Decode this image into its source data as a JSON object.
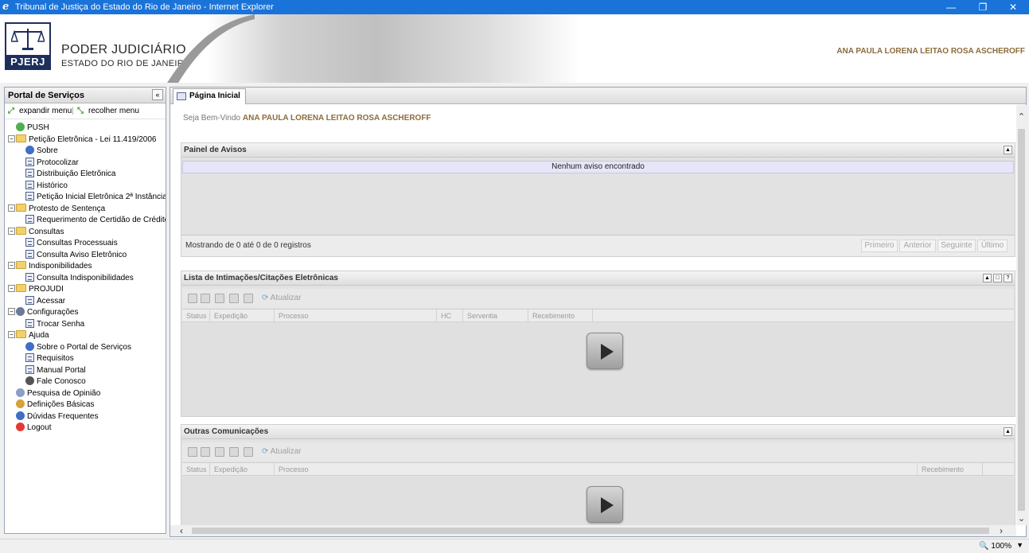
{
  "window": {
    "title": "Tribunal de Justiça do Estado do Rio de Janeiro - Internet Explorer",
    "minimize": "—",
    "restore": "❐",
    "close": "✕"
  },
  "header": {
    "logo_text": "PJERJ",
    "org_line1": "PODER JUDICIÁRIO",
    "org_line2": "ESTADO DO RIO DE JANEIRO",
    "user_name": "ANA PAULA LORENA LEITAO ROSA ASCHEROFF"
  },
  "sidebar": {
    "title": "Portal de Serviços",
    "collapse_glyph": "«",
    "expand_label": "expandir menu",
    "collapse_label": "recolher menu",
    "separator": "|",
    "tree": [
      {
        "label": "PUSH",
        "icon": "green-plus-icon",
        "level": 0,
        "toggle": ""
      },
      {
        "label": "Petição Eletrônica - Lei 11.419/2006",
        "icon": "folder-open-icon",
        "level": 0,
        "toggle": "−"
      },
      {
        "label": "Sobre",
        "icon": "info-icon",
        "level": 1,
        "toggle": ""
      },
      {
        "label": "Protocolizar",
        "icon": "page-icon",
        "level": 1,
        "toggle": ""
      },
      {
        "label": "Distribuição Eletrônica",
        "icon": "page-icon",
        "level": 1,
        "toggle": ""
      },
      {
        "label": "Histórico",
        "icon": "page-icon",
        "level": 1,
        "toggle": ""
      },
      {
        "label": "Petição Inicial Eletrônica 2ª Instância",
        "icon": "page-icon",
        "level": 1,
        "toggle": ""
      },
      {
        "label": "Protesto de Sentença",
        "icon": "folder-open-icon",
        "level": 0,
        "toggle": "−"
      },
      {
        "label": "Requerimento de Certidão de Crédito para",
        "icon": "page-icon",
        "level": 1,
        "toggle": ""
      },
      {
        "label": "Consultas",
        "icon": "folder-open-icon",
        "level": 0,
        "toggle": "−"
      },
      {
        "label": "Consultas Processuais",
        "icon": "page-icon",
        "level": 1,
        "toggle": ""
      },
      {
        "label": "Consulta Aviso Eletrônico",
        "icon": "page-icon",
        "level": 1,
        "toggle": ""
      },
      {
        "label": "Indisponibilidades",
        "icon": "folder-open-icon",
        "level": 0,
        "toggle": "−"
      },
      {
        "label": "Consulta Indisponibilidades",
        "icon": "page-icon",
        "level": 1,
        "toggle": ""
      },
      {
        "label": "PROJUDI",
        "icon": "folder-open-icon",
        "level": 0,
        "toggle": "−"
      },
      {
        "label": "Acessar",
        "icon": "page-icon",
        "level": 1,
        "toggle": ""
      },
      {
        "label": "Configurações",
        "icon": "wrench-icon",
        "level": 0,
        "toggle": "−"
      },
      {
        "label": "Trocar Senha",
        "icon": "page-icon",
        "level": 1,
        "toggle": ""
      },
      {
        "label": "Ajuda",
        "icon": "folder-open-icon",
        "level": 0,
        "toggle": "−"
      },
      {
        "label": "Sobre o Portal de Serviços",
        "icon": "info-icon",
        "level": 1,
        "toggle": ""
      },
      {
        "label": "Requisitos",
        "icon": "page-icon",
        "level": 1,
        "toggle": ""
      },
      {
        "label": "Manual Portal",
        "icon": "page-icon",
        "level": 1,
        "toggle": ""
      },
      {
        "label": "Fale Conosco",
        "icon": "headset-icon",
        "level": 1,
        "toggle": ""
      },
      {
        "label": "Pesquisa de Opinião",
        "icon": "speech-bubble-icon",
        "level": 0,
        "toggle": ""
      },
      {
        "label": "Definições Básicas",
        "icon": "pencil-icon",
        "level": 0,
        "toggle": ""
      },
      {
        "label": "Dúvidas Frequentes",
        "icon": "help-icon",
        "level": 0,
        "toggle": ""
      },
      {
        "label": "Logout",
        "icon": "logout-icon",
        "level": 0,
        "toggle": ""
      }
    ]
  },
  "main": {
    "tab_label": "Página Inicial",
    "welcome_prefix": "Seja Bem-Vindo",
    "welcome_name": "ANA PAULA LORENA LEITAO ROSA ASCHEROFF",
    "avisos": {
      "title": "Painel de Avisos",
      "empty": "Nenhum aviso encontrado",
      "info": "Mostrando de 0 até 0 de 0 registros",
      "pager": [
        "Primeiro",
        "Anterior",
        "Seguinte",
        "Último"
      ]
    },
    "intimacoes": {
      "title": "Lista de Intimações/Citações Eletrônicas",
      "refresh": "Atualizar",
      "columns": [
        "Status",
        "Expedição",
        "Processo",
        "HC",
        "Serventia",
        "Recebimento"
      ]
    },
    "outras": {
      "title": "Outras Comunicações",
      "refresh": "Atualizar",
      "columns": [
        "Status",
        "Expedição",
        "Processo",
        "Recebimento"
      ]
    }
  },
  "status": {
    "zoom": "🔍 100%",
    "zoom_arrow": "▼"
  }
}
